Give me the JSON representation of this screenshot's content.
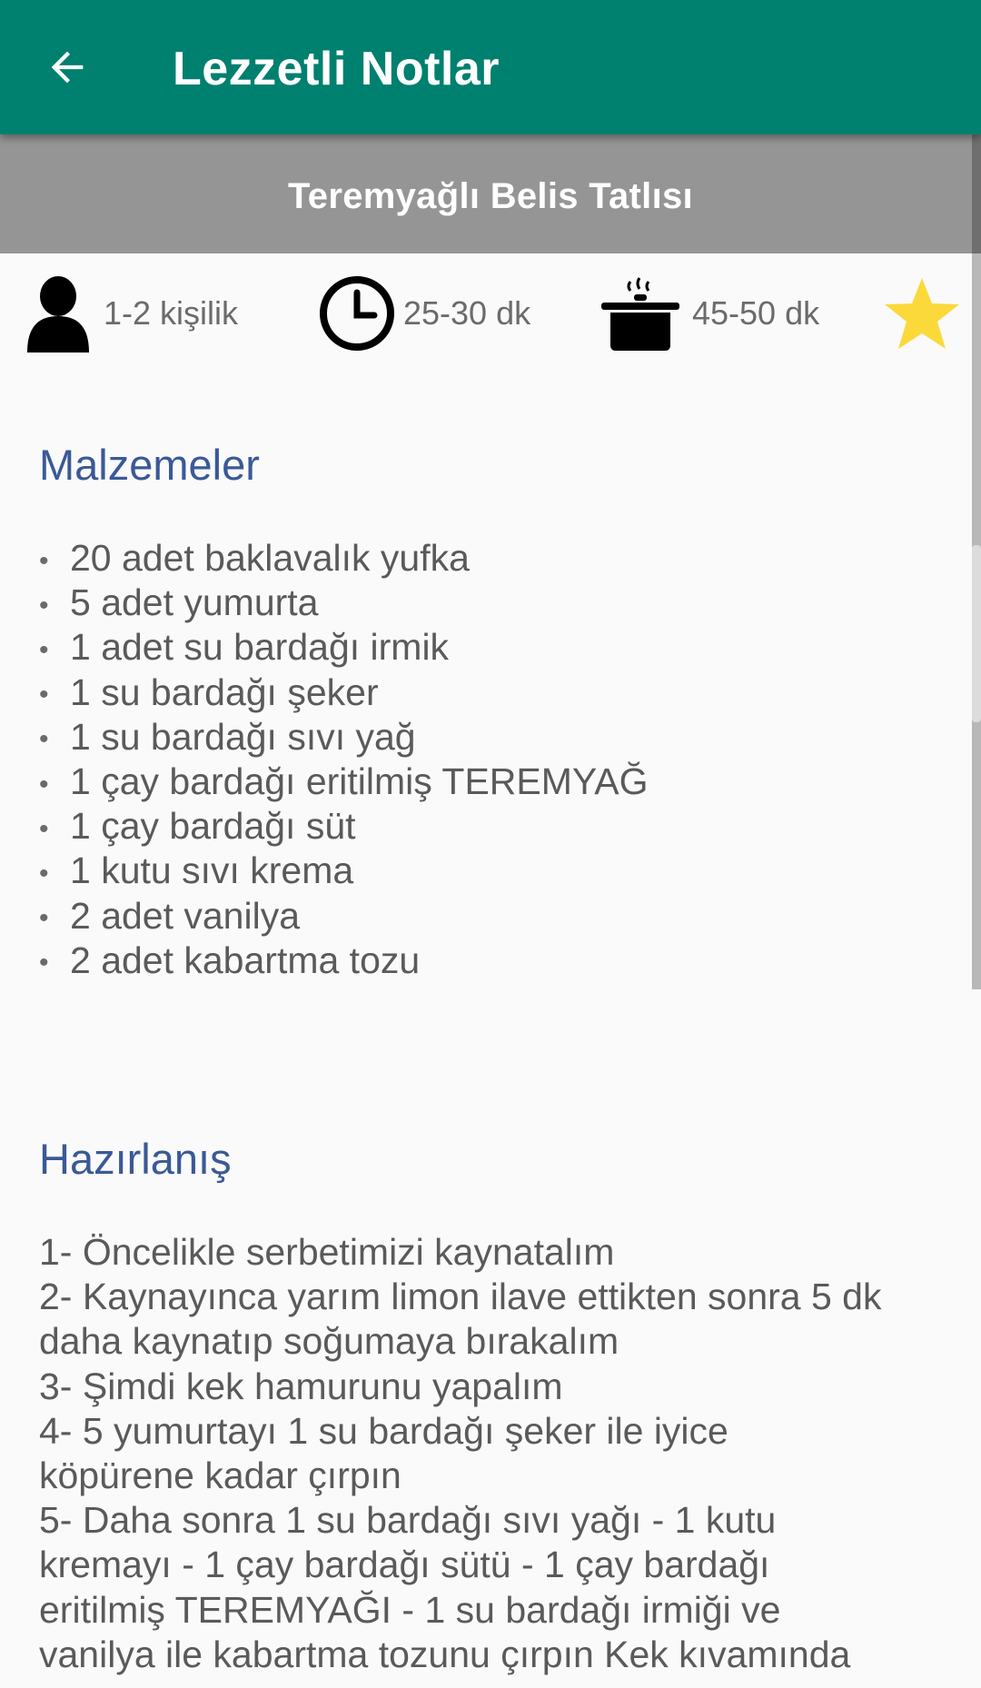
{
  "appbar": {
    "back_icon": "arrow-left-icon",
    "title": "Lezzetli Notlar"
  },
  "recipe": {
    "title": "Teremyağlı Belis Tatlısı",
    "servings": "1-2  kişilik",
    "prep_time": "25-30 dk",
    "cook_time": "45-50 dk",
    "favorite_icon": "star-icon",
    "favorite_color": "#fbd93b"
  },
  "ingredients": {
    "title": "Malzemeler",
    "items": [
      "20 adet baklavalık yufka",
      "5 adet yumurta",
      "1 adet su bardağı irmik",
      "1 su bardağı şeker",
      "1 su bardağı sıvı yağ",
      "1 çay bardağı eritilmiş TEREMYAĞ",
      "1 çay bardağı süt",
      "1 kutu sıvı krema",
      "2 adet vanilya",
      "2 adet kabartma tozu"
    ]
  },
  "preparation": {
    "title": "Hazırlanış",
    "lines": [
      "1- Öncelikle serbetimizi kaynatalım",
      "2- Kaynayınca yarım limon ilave ettikten sonra 5 dk",
      "daha kaynatıp soğumaya bırakalım",
      "3- Şimdi kek hamurunu yapalım",
      "4- 5 yumurtayı 1 su bardağı şeker ile iyice",
      "köpürene kadar çırpın",
      "5- Daha sonra 1 su bardağı sıvı yağı - 1 kutu",
      "kremayı - 1 çay bardağı sütü - 1 çay bardağı",
      "eritilmiş TEREMYAĞI - 1 su bardağı irmiği ve",
      "vanilya ile kabartma tozunu çırpın Kek kıvamında"
    ]
  },
  "colors": {
    "appbar": "#00806f",
    "recipe_header": "#959595",
    "section_title": "#3a5997"
  }
}
